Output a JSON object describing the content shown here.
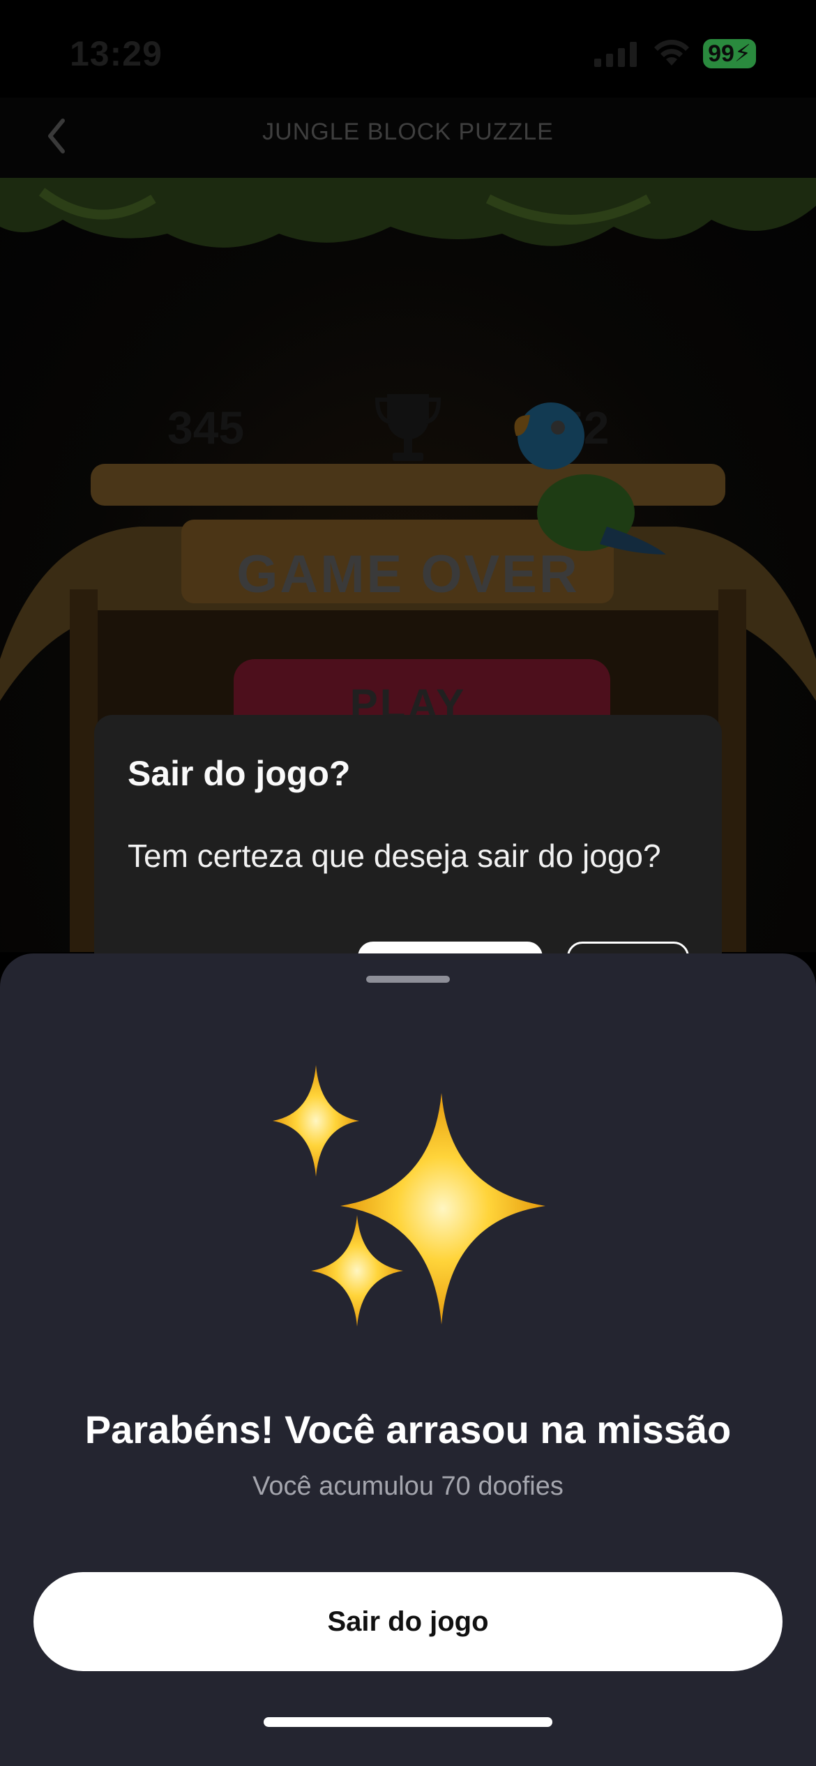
{
  "status_bar": {
    "time": "13:29",
    "battery": "99"
  },
  "navbar": {
    "title": "JUNGLE BLOCK PUZZLE"
  },
  "game": {
    "score_current": "345",
    "score_best": "52",
    "game_over_text": "GAME OVER",
    "play_text": "PLAY"
  },
  "dialog": {
    "title": "Sair do jogo?",
    "message": "Tem certeza que deseja sair do jogo?"
  },
  "sheet": {
    "title": "Parabéns! Você arrasou na missão",
    "subtitle": "Você acumulou 70 doofies",
    "button_label": "Sair do jogo",
    "icon": "sparkles-icon"
  },
  "colors": {
    "sheet_background": "#242530",
    "dialog_background": "#1f1f1f",
    "battery_green": "#2f9a45",
    "sparkle_gold": "#f5c021"
  }
}
